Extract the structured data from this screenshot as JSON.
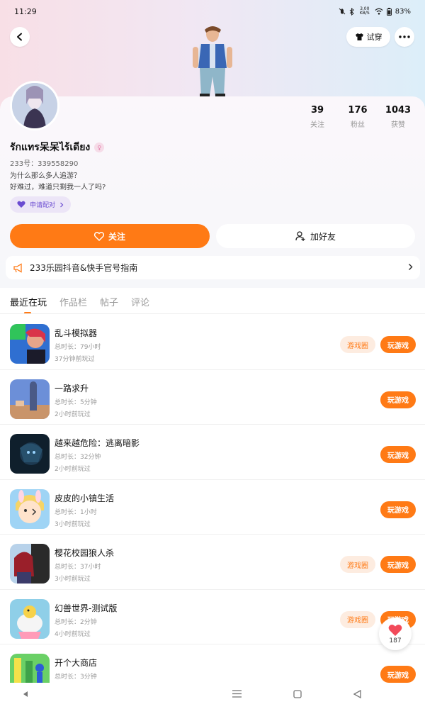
{
  "status_bar": {
    "time": "11:29",
    "speed": "3.00 KB/S",
    "battery": "83%",
    "icons": [
      "mute-icon",
      "bluetooth-icon",
      "wifi-icon",
      "battery-icon"
    ]
  },
  "header": {
    "tryon_label": "试穿",
    "icons": [
      "back-icon",
      "shirt-icon",
      "more-icon"
    ]
  },
  "profile": {
    "username": "รักแทร呆呆ไร้เดียง",
    "uid": "233号：339558290",
    "bio_line1": "为什么那么多人追游？",
    "bio_line2": "好难过，难道只剩我一人了吗?",
    "pair_label": "申请配对",
    "stats": [
      {
        "num": "39",
        "label": "关注"
      },
      {
        "num": "176",
        "label": "粉丝"
      },
      {
        "num": "1043",
        "label": "获赞"
      }
    ]
  },
  "actions": {
    "follow_label": "关注",
    "add_friend_label": "加好友"
  },
  "notice": {
    "text": "233乐园抖音&快手官号指南"
  },
  "tabs": [
    {
      "label": "最近在玩",
      "active": true
    },
    {
      "label": "作品栏",
      "active": false
    },
    {
      "label": "帖子",
      "active": false
    },
    {
      "label": "评论",
      "active": false
    }
  ],
  "games": [
    {
      "name": "乱斗模拟器",
      "duration": "总时长：79小时",
      "last": "37分钟前玩过",
      "has_circle": true
    },
    {
      "name": "一路求升",
      "duration": "总时长：5分钟",
      "last": "2小时前玩过",
      "has_circle": false
    },
    {
      "name": "越来越危险：逃离暗影",
      "duration": "总时长：32分钟",
      "last": "2小时前玩过",
      "has_circle": false
    },
    {
      "name": "皮皮的小镇生活",
      "duration": "总时长：1小时",
      "last": "3小时前玩过",
      "has_circle": false
    },
    {
      "name": "樱花校园狼人杀",
      "duration": "总时长：37小时",
      "last": "3小时前玩过",
      "has_circle": true
    },
    {
      "name": "幻兽世界-测试版",
      "duration": "总时长：2分钟",
      "last": "4小时前玩过",
      "has_circle": true
    },
    {
      "name": "开个大商店",
      "duration": "总时长：3分钟",
      "last": "",
      "has_circle": false
    }
  ],
  "game_buttons": {
    "circle_label": "游戏圈",
    "play_label": "玩游戏"
  },
  "float_like": {
    "count": "187"
  },
  "colors": {
    "accent": "#ff7a15",
    "pair_bg": "#ece5f7",
    "pair_text": "#6a4bd1"
  }
}
